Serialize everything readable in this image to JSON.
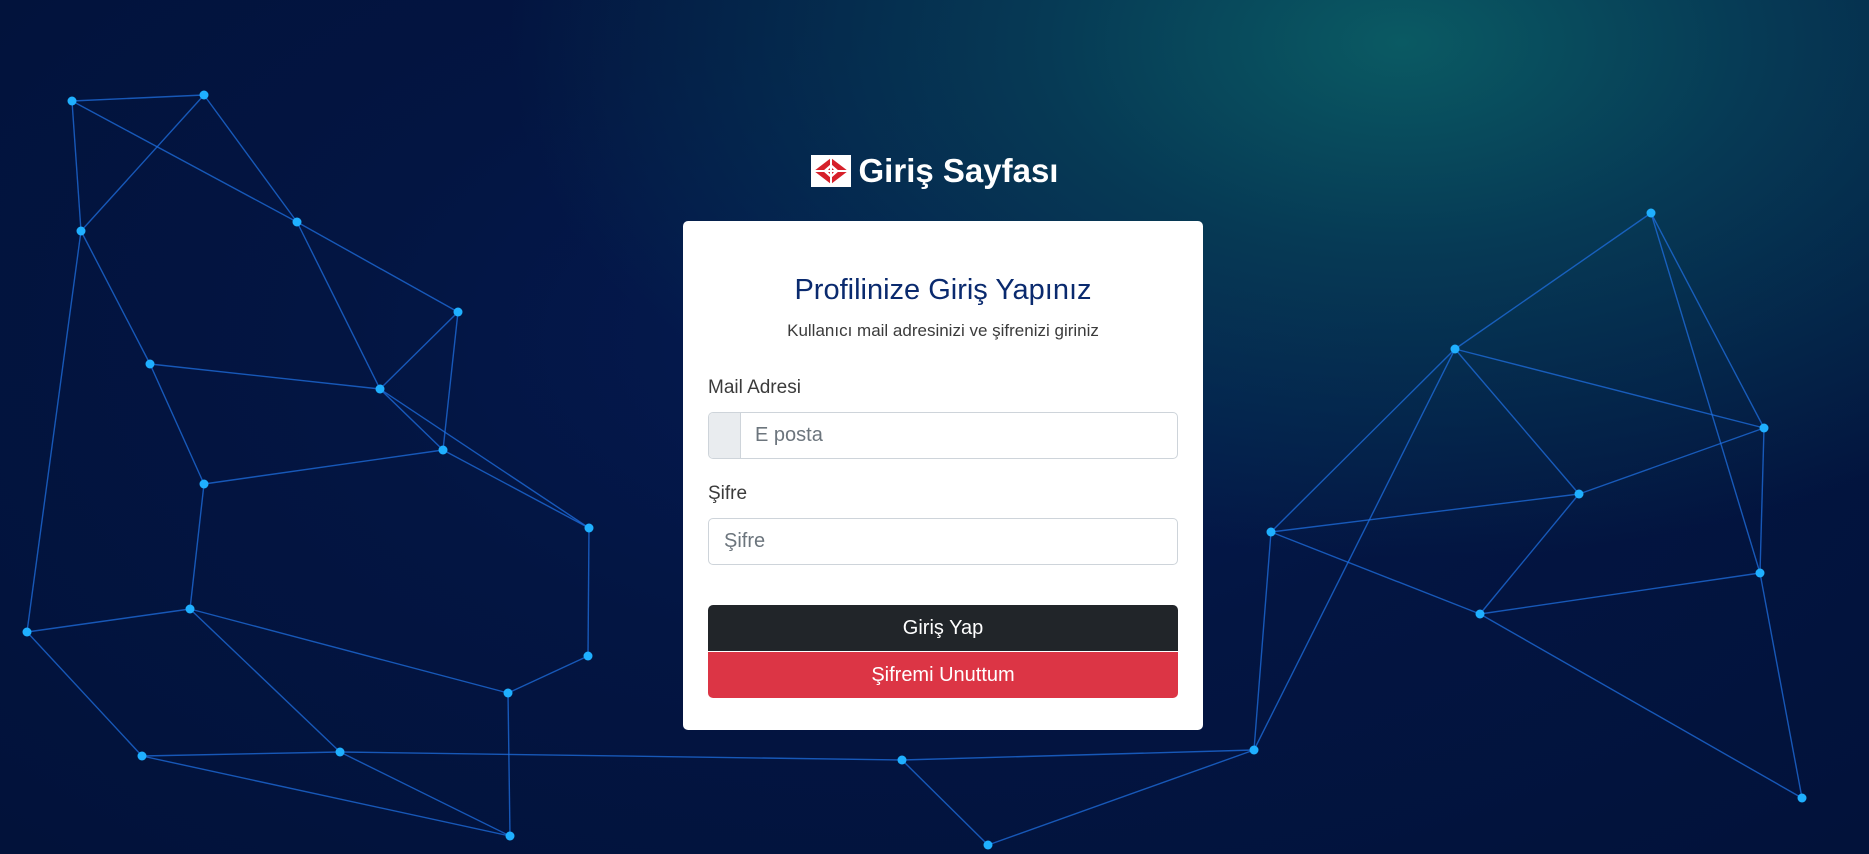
{
  "header": {
    "title": "Giriş Sayfası",
    "logo_icon": "red-diamond-logo-icon"
  },
  "login_card": {
    "heading": "Profilinize Giriş Yapınız",
    "subheading": "Kullanıcı mail adresinizi ve şifrenizi giriniz",
    "email": {
      "label": "Mail Adresi",
      "placeholder": "E posta",
      "value": ""
    },
    "password": {
      "label": "Şifre",
      "placeholder": "Şifre",
      "value": ""
    },
    "login_button": "Giriş Yap",
    "forgot_button": "Şifremi Unuttum"
  },
  "colors": {
    "heading": "#0a2a6e",
    "login_button_bg": "#212529",
    "forgot_button_bg": "#dc3545",
    "logo_red": "#d6202a",
    "network_line": "#1f6fe0",
    "network_node": "#1fb0ff"
  }
}
